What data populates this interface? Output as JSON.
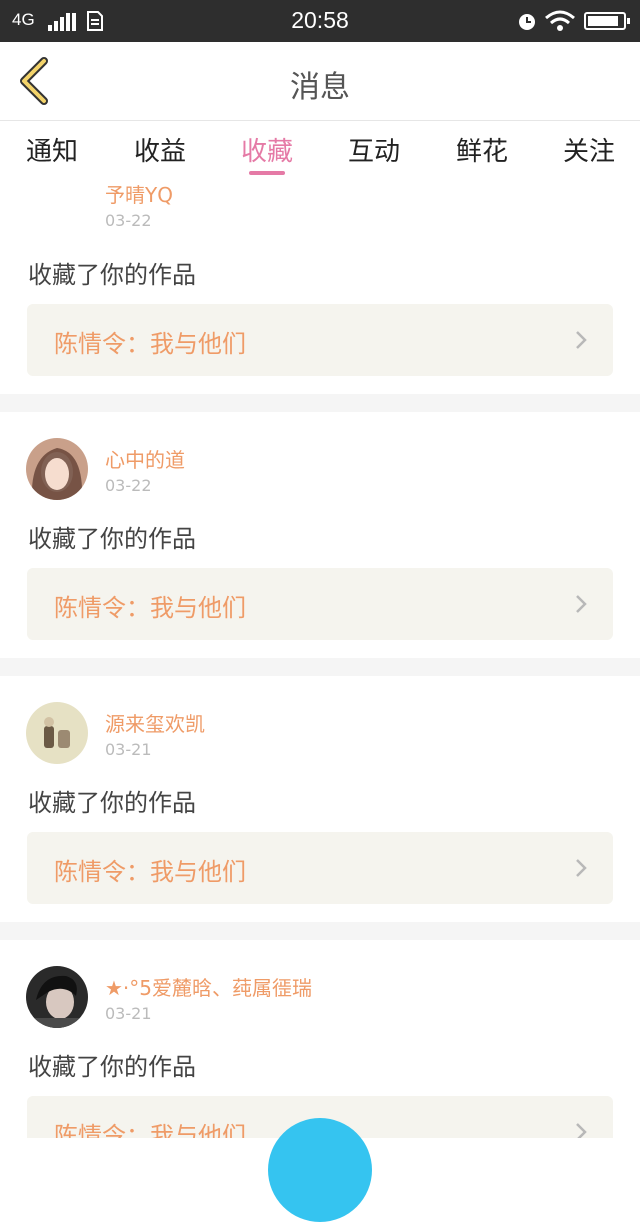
{
  "status_bar": {
    "network": "4G",
    "time": "20:58"
  },
  "header": {
    "title": "消息"
  },
  "tabs": [
    {
      "label": "通知",
      "active": false
    },
    {
      "label": "收益",
      "active": false
    },
    {
      "label": "收藏",
      "active": true
    },
    {
      "label": "互动",
      "active": false
    },
    {
      "label": "鲜花",
      "active": false
    },
    {
      "label": "关注",
      "active": false
    }
  ],
  "messages": [
    {
      "user": "予晴YQ",
      "date": "03-22",
      "action": "收藏了你的作品",
      "work": "陈情令：我与他们"
    },
    {
      "user": "心中的道",
      "date": "03-22",
      "action": "收藏了你的作品",
      "work": "陈情令：我与他们"
    },
    {
      "user": "源来玺欢凯",
      "date": "03-21",
      "action": "收藏了你的作品",
      "work": "陈情令：我与他们"
    },
    {
      "user": "★·°5爱麓晗、莼属徰瑞",
      "date": "03-21",
      "action": "收藏了你的作品",
      "work": "陈情令：我与他们"
    }
  ],
  "colors": {
    "accent_tab": "#e57aa6",
    "username": "#ef9b67",
    "fab": "#35c4f0"
  }
}
